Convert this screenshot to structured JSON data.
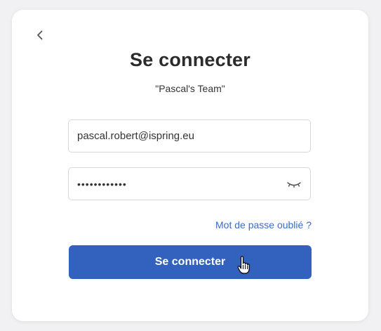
{
  "login": {
    "title": "Se connecter",
    "team": "\"Pascal's Team\"",
    "email_value": "pascal.robert@ispring.eu",
    "password_value": "••••••••••••",
    "forgot_label": "Mot de passe oublié ?",
    "submit_label": "Se connecter"
  },
  "colors": {
    "accent": "#3362be",
    "link": "#3a6cc7",
    "background": "#f1f1f3"
  },
  "icons": {
    "back": "chevron-left-icon",
    "password_toggle": "eye-closed-icon",
    "cursor": "hand-pointer-cursor"
  }
}
